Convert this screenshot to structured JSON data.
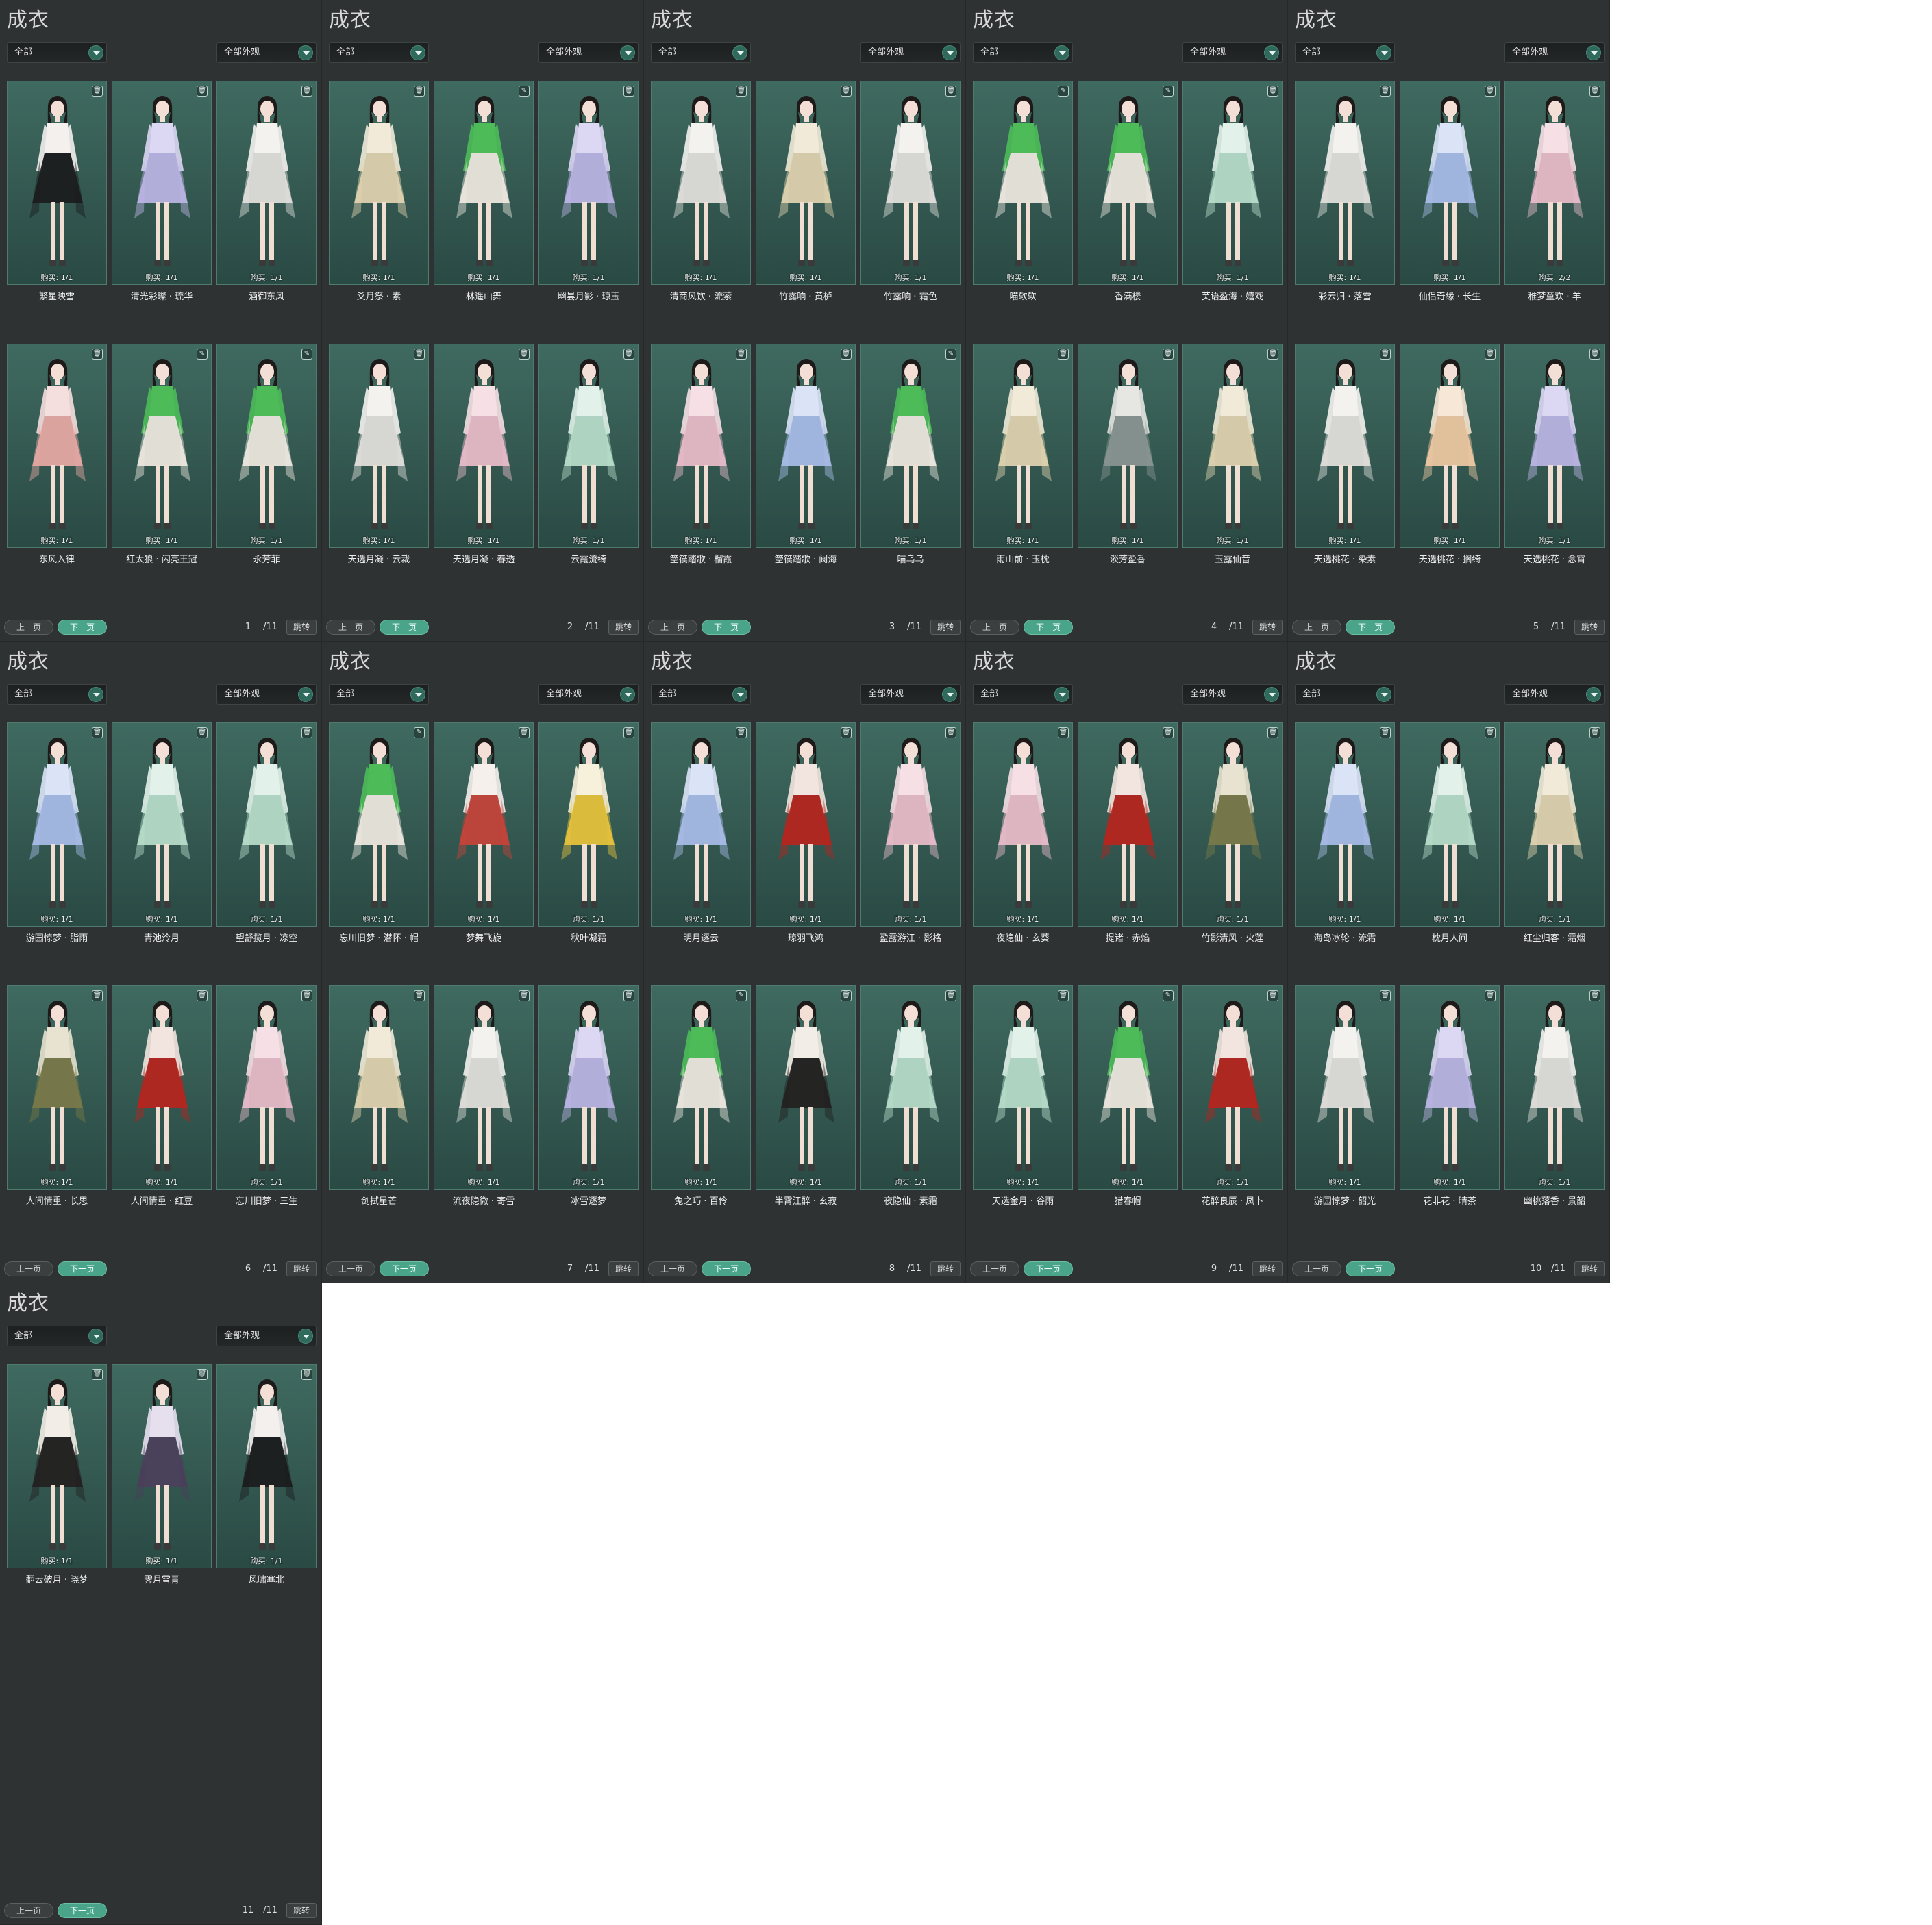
{
  "panel_title": "成衣",
  "filter_category": "全部",
  "filter_appearance": "全部外观",
  "prev_label": "上一页",
  "next_label": "下一页",
  "jump_label": "跳转",
  "total_pages": "/11",
  "colors": {
    "panel_bg": "#2f3233",
    "card_bg": "#3f6a60",
    "accent": "#4aa48a"
  },
  "panels": [
    {
      "page": "1",
      "items": [
        {
          "name": "繁星映雪",
          "buy": "购买: 1/1",
          "tag": "trash-icon",
          "outfit": "dark-white"
        },
        {
          "name": "清光彩璨 · 琉华",
          "buy": "购买: 1/1",
          "tag": "trash-icon",
          "outfit": "lavender"
        },
        {
          "name": "酒御东风",
          "buy": "购买: 1/1",
          "tag": "trash-icon",
          "outfit": "white"
        },
        {
          "name": "东风入律",
          "buy": "购买: 1/1",
          "tag": "trash-icon",
          "outfit": "pink-long"
        },
        {
          "name": "红太狼 · 闪亮王冠",
          "buy": "购买: 1/1",
          "tag": "edit-icon",
          "outfit": "green"
        },
        {
          "name": "永芳菲",
          "buy": "购买: 1/1",
          "tag": "edit-icon",
          "outfit": "green"
        }
      ]
    },
    {
      "page": "2",
      "items": [
        {
          "name": "爻月祭 · 素",
          "buy": "购买: 1/1",
          "tag": "trash-icon",
          "outfit": "cream"
        },
        {
          "name": "林遥山舞",
          "buy": "购买: 1/1",
          "tag": "edit-icon",
          "outfit": "green"
        },
        {
          "name": "幽昙月影 · 琼玉",
          "buy": "购买: 1/1",
          "tag": "trash-icon",
          "outfit": "lavender"
        },
        {
          "name": "天选月凝 · 云裁",
          "buy": "购买: 1/1",
          "tag": "trash-icon",
          "outfit": "white"
        },
        {
          "name": "天选月凝 · 春透",
          "buy": "购买: 1/1",
          "tag": "trash-icon",
          "outfit": "pink"
        },
        {
          "name": "云霞流绮",
          "buy": "购买: 1/1",
          "tag": "trash-icon",
          "outfit": "mint"
        }
      ]
    },
    {
      "page": "3",
      "items": [
        {
          "name": "清商风饮 · 流萦",
          "buy": "购买: 1/1",
          "tag": "trash-icon",
          "outfit": "white"
        },
        {
          "name": "竹露响 · 黄栌",
          "buy": "购买: 1/1",
          "tag": "trash-icon",
          "outfit": "cream"
        },
        {
          "name": "竹露响 · 霜色",
          "buy": "购买: 1/1",
          "tag": "trash-icon",
          "outfit": "white"
        },
        {
          "name": "箜篌踏歌 · 榴霞",
          "buy": "购买: 1/1",
          "tag": "trash-icon",
          "outfit": "pink"
        },
        {
          "name": "箜篌踏歌 · 阆海",
          "buy": "购买: 1/1",
          "tag": "trash-icon",
          "outfit": "blue"
        },
        {
          "name": "喵乌乌",
          "buy": "购买: 1/1",
          "tag": "edit-icon",
          "outfit": "green"
        }
      ]
    },
    {
      "page": "4",
      "items": [
        {
          "name": "喵软软",
          "buy": "购买: 1/1",
          "tag": "edit-icon",
          "outfit": "green"
        },
        {
          "name": "香满楼",
          "buy": "购买: 1/1",
          "tag": "edit-icon",
          "outfit": "green"
        },
        {
          "name": "芙语盈海 · 嬉戏",
          "buy": "购买: 1/1",
          "tag": "trash-icon",
          "outfit": "mint"
        },
        {
          "name": "雨山前 · 玉枕",
          "buy": "购买: 1/1",
          "tag": "trash-icon",
          "outfit": "cream"
        },
        {
          "name": "淡芳盈香",
          "buy": "购买: 1/1",
          "tag": "trash-icon",
          "outfit": "gray"
        },
        {
          "name": "玉露仙音",
          "buy": "购买: 1/1",
          "tag": "trash-icon",
          "outfit": "cream"
        }
      ]
    },
    {
      "page": "5",
      "items": [
        {
          "name": "彩云归 · 落雪",
          "buy": "购买: 1/1",
          "tag": "trash-icon",
          "outfit": "white"
        },
        {
          "name": "仙侣奇缘 · 长生",
          "buy": "购买: 1/1",
          "tag": "trash-icon",
          "outfit": "blue"
        },
        {
          "name": "稚梦童欢 · 羊",
          "buy": "购买: 2/2",
          "tag": "trash-icon",
          "outfit": "pink"
        },
        {
          "name": "天选桃花 · 染素",
          "buy": "购买: 1/1",
          "tag": "trash-icon",
          "outfit": "white"
        },
        {
          "name": "天选桃花 · 搁绮",
          "buy": "购买: 1/1",
          "tag": "trash-icon",
          "outfit": "peach"
        },
        {
          "name": "天选桃花 · 念霄",
          "buy": "购买: 1/1",
          "tag": "trash-icon",
          "outfit": "lavender"
        }
      ]
    },
    {
      "page": "6",
      "items": [
        {
          "name": "游园惊梦 · 脂雨",
          "buy": "购买: 1/1",
          "tag": "trash-icon",
          "outfit": "blue"
        },
        {
          "name": "青池泠月",
          "buy": "购买: 1/1",
          "tag": "trash-icon",
          "outfit": "mint"
        },
        {
          "name": "望舒揽月 · 凉空",
          "buy": "购买: 1/1",
          "tag": "trash-icon",
          "outfit": "mint"
        },
        {
          "name": "人间情重 · 长思",
          "buy": "购买: 1/1",
          "tag": "trash-icon",
          "outfit": "olive"
        },
        {
          "name": "人间情重 · 红豆",
          "buy": "购买: 1/1",
          "tag": "trash-icon",
          "outfit": "red"
        },
        {
          "name": "忘川旧梦 · 三生",
          "buy": "购买: 1/1",
          "tag": "trash-icon",
          "outfit": "pink"
        }
      ]
    },
    {
      "page": "7",
      "items": [
        {
          "name": "忘川旧梦 · 潜怀 · 帽",
          "buy": "购买: 1/1",
          "tag": "edit-icon",
          "outfit": "green"
        },
        {
          "name": "梦舞飞旋",
          "buy": "购买: 1/1",
          "tag": "trash-icon",
          "outfit": "white-red"
        },
        {
          "name": "秋叶凝霜",
          "buy": "购买: 1/1",
          "tag": "trash-icon",
          "outfit": "yellow"
        },
        {
          "name": "剑拭星芒",
          "buy": "购买: 1/1",
          "tag": "trash-icon",
          "outfit": "cream"
        },
        {
          "name": "流夜隐微 · 寄雪",
          "buy": "购买: 1/1",
          "tag": "trash-icon",
          "outfit": "white"
        },
        {
          "name": "冰雪逐梦",
          "buy": "购买: 1/1",
          "tag": "trash-icon",
          "outfit": "lavender"
        }
      ]
    },
    {
      "page": "8",
      "items": [
        {
          "name": "明月逐云",
          "buy": "购买: 1/1",
          "tag": "trash-icon",
          "outfit": "blue"
        },
        {
          "name": "琼羽飞鸿",
          "buy": "购买: 1/1",
          "tag": "trash-icon",
          "outfit": "red"
        },
        {
          "name": "盈露游江 · 影格",
          "buy": "购买: 1/1",
          "tag": "trash-icon",
          "outfit": "pink"
        },
        {
          "name": "兔之巧 · 百伶",
          "buy": "购买: 1/1",
          "tag": "edit-icon",
          "outfit": "green"
        },
        {
          "name": "半霄江醉 · 玄寂",
          "buy": "购买: 1/1",
          "tag": "trash-icon",
          "outfit": "black"
        },
        {
          "name": "夜隐仙 · 素霜",
          "buy": "购买: 1/1",
          "tag": "trash-icon",
          "outfit": "mint"
        }
      ]
    },
    {
      "page": "9",
      "items": [
        {
          "name": "夜隐仙 · 玄葵",
          "buy": "购买: 1/1",
          "tag": "trash-icon",
          "outfit": "pink"
        },
        {
          "name": "提诸 · 赤焰",
          "buy": "购买: 1/1",
          "tag": "trash-icon",
          "outfit": "red"
        },
        {
          "name": "竹影清风 · 火莲",
          "buy": "购买: 1/1",
          "tag": "trash-icon",
          "outfit": "olive"
        },
        {
          "name": "天选金月 · 谷雨",
          "buy": "购买: 1/1",
          "tag": "trash-icon",
          "outfit": "mint"
        },
        {
          "name": "猎春帽",
          "buy": "购买: 1/1",
          "tag": "edit-icon",
          "outfit": "green"
        },
        {
          "name": "花醉良辰 · 凤卜",
          "buy": "购买: 1/1",
          "tag": "trash-icon",
          "outfit": "red"
        }
      ]
    },
    {
      "page": "10",
      "items": [
        {
          "name": "海岛冰轮 · 流霜",
          "buy": "购买: 1/1",
          "tag": "trash-icon",
          "outfit": "blue"
        },
        {
          "name": "枕月人间",
          "buy": "购买: 1/1",
          "tag": "trash-icon",
          "outfit": "mint"
        },
        {
          "name": "红尘归客 · 霜烟",
          "buy": "购买: 1/1",
          "tag": "trash-icon",
          "outfit": "cream"
        },
        {
          "name": "游园惊梦 · 韶光",
          "buy": "购买: 1/1",
          "tag": "trash-icon",
          "outfit": "white"
        },
        {
          "name": "花非花 · 晴茶",
          "buy": "购买: 1/1",
          "tag": "trash-icon",
          "outfit": "lavender"
        },
        {
          "name": "幽桃落香 · 景韶",
          "buy": "购买: 1/1",
          "tag": "trash-icon",
          "outfit": "white"
        }
      ]
    },
    {
      "page": "11",
      "items": [
        {
          "name": "翻云破月 · 晓梦",
          "buy": "购买: 1/1",
          "tag": "trash-icon",
          "outfit": "black"
        },
        {
          "name": "霁月雪青",
          "buy": "购买: 1/1",
          "tag": "trash-icon",
          "outfit": "purple"
        },
        {
          "name": "风啸塞北",
          "buy": "购买: 1/1",
          "tag": "trash-icon",
          "outfit": "dark-white"
        }
      ]
    }
  ]
}
